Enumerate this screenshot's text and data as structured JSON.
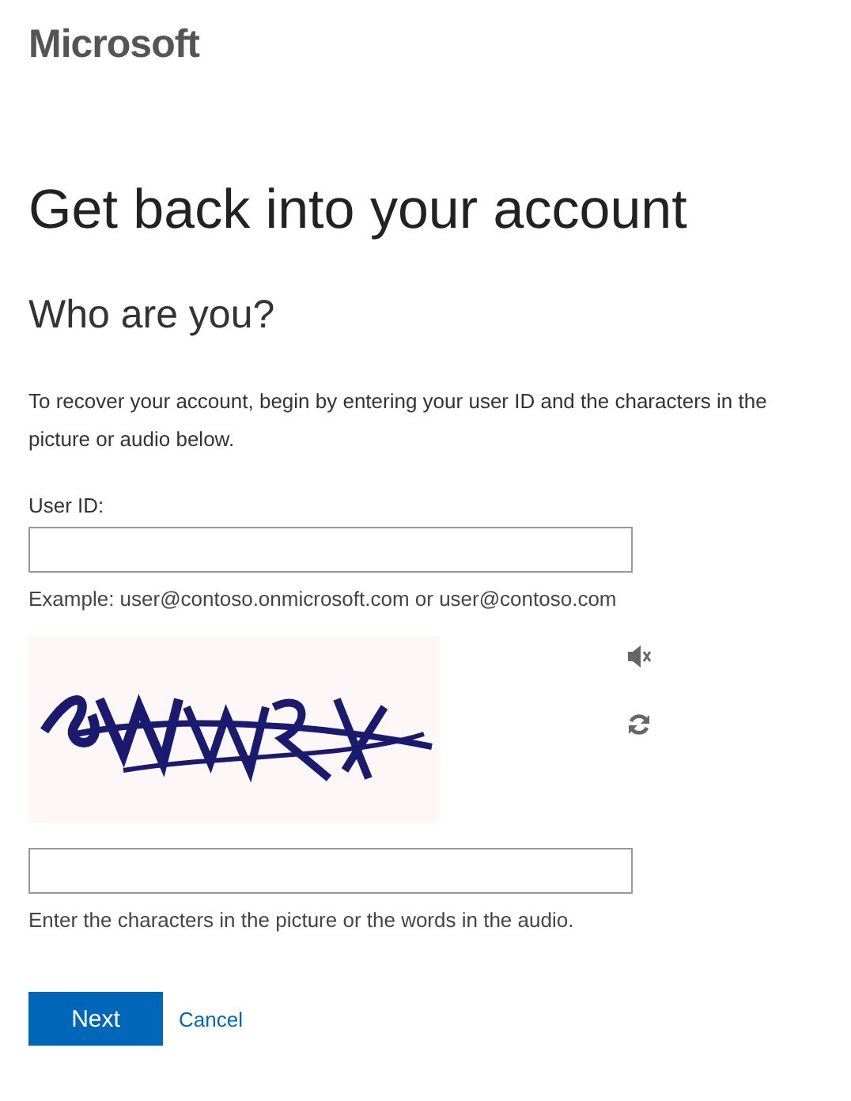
{
  "logo": "Microsoft",
  "title": "Get back into your account",
  "subtitle": "Who are you?",
  "intro": "To recover your account, begin by entering your user ID and the characters in the picture or audio below.",
  "user_id": {
    "label": "User ID:",
    "example": "Example: user@contoso.onmicrosoft.com or user@contoso.com"
  },
  "captcha": {
    "kind": "picture",
    "hint": "Enter the characters in the picture or the words in the audio."
  },
  "buttons": [
    {
      "label": "Next",
      "kind": "primary"
    },
    {
      "label": "Cancel",
      "kind": "link"
    }
  ]
}
